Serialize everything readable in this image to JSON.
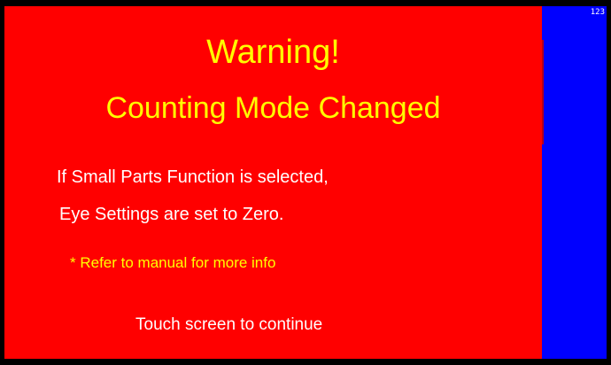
{
  "dialog": {
    "title": "Warning!",
    "subtitle": "Counting Mode Changed",
    "message_line_1": "If Small Parts Function is selected,",
    "message_line_2": "Eye Settings are set to Zero.",
    "note": "* Refer to manual for more info",
    "continue_prompt": "Touch screen to continue"
  },
  "side_panel": {
    "number": "123"
  },
  "colors": {
    "background": "#ff0000",
    "side_panel": "#0000ff",
    "title_text": "#ffff00",
    "body_text": "#ffffff",
    "note_text": "#ffff00",
    "border": "#000000"
  }
}
